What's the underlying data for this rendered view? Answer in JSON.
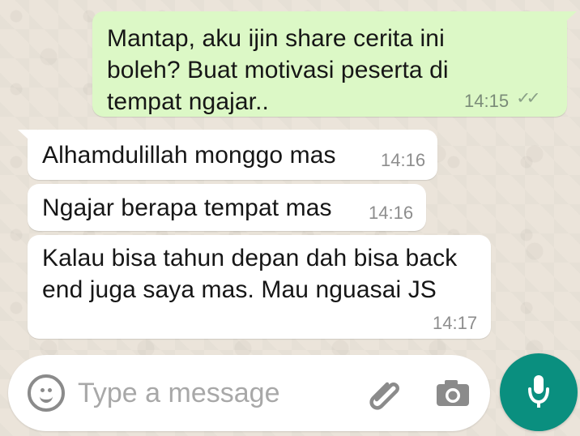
{
  "messages": [
    {
      "direction": "outgoing",
      "text": "Mantap, aku ijin share cerita ini\nboleh? Buat motivasi peserta di\ntempat ngajar..",
      "time": "14:15",
      "status_icon": "double-check-icon"
    },
    {
      "direction": "incoming",
      "text": "Alhamdulillah monggo mas",
      "time": "14:16"
    },
    {
      "direction": "incoming",
      "text": "Ngajar berapa tempat mas",
      "time": "14:16"
    },
    {
      "direction": "incoming",
      "text": "Kalau bisa tahun depan dah bisa back\nend juga saya mas. Mau nguasai JS",
      "time": "14:17"
    }
  ],
  "composer": {
    "placeholder": "Type a message",
    "value": "",
    "emoji_icon": "emoji-icon",
    "attach_icon": "paperclip-icon",
    "camera_icon": "camera-icon",
    "mic_icon": "microphone-icon"
  },
  "colors": {
    "outgoing_bubble": "#dcf8c6",
    "incoming_bubble": "#ffffff",
    "mic_button": "#0a8f7f",
    "wallpaper": "#ebe4da"
  }
}
